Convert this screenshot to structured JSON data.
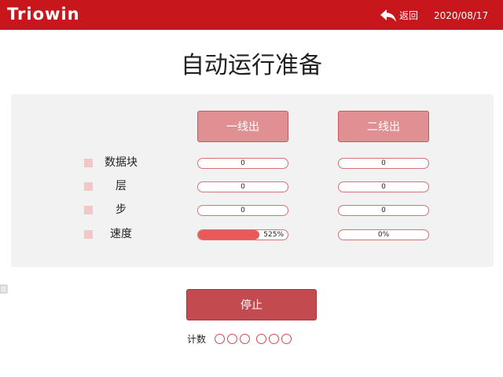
{
  "header": {
    "logo_text": "Triowin",
    "back_label": "返回",
    "back_icon": "back-arrow-icon",
    "date": "2020/08/17",
    "bar_color": "#c8161d"
  },
  "main": {
    "title": "自动运行准备",
    "lines": [
      {
        "label": "一线出"
      },
      {
        "label": "二线出"
      }
    ],
    "rows": [
      {
        "label": "数据块",
        "line1": "0",
        "line2": "0"
      },
      {
        "label": "层",
        "line1": "0",
        "line2": "0"
      },
      {
        "label": "步",
        "line1": "0",
        "line2": "0"
      },
      {
        "label": "速度",
        "line1": "525%",
        "line2": "0%",
        "line1_fill_fraction": 0.68,
        "line2_fill_fraction": 0
      }
    ],
    "stop_label": "停止",
    "count_label": "计数",
    "count_indicator_count": 6
  },
  "colors": {
    "accent": "#c8161d",
    "button": "#e09093",
    "stop_button": "#c34a4e",
    "progress": "#e85a5a"
  }
}
